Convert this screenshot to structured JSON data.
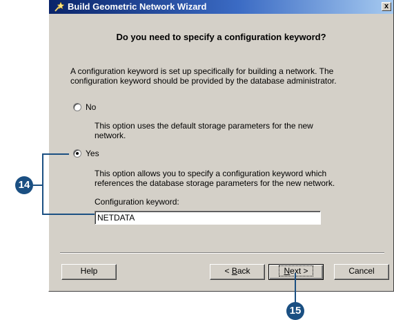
{
  "window": {
    "title": "Build Geometric Network Wizard",
    "close_label": "x"
  },
  "question": "Do you need to specify a configuration keyword?",
  "intro": {
    "line1": "A configuration keyword is set up specifically for building a network. The",
    "line2": "configuration keyword should be provided by the database administrator."
  },
  "options": {
    "no": {
      "label": "No",
      "selected": false,
      "desc_line1": "This option uses the default storage parameters for the new",
      "desc_line2": "network."
    },
    "yes": {
      "label": "Yes",
      "selected": true,
      "desc_line1": "This option allows you to specify a configuration keyword which",
      "desc_line2": "references the database storage parameters for the new network."
    }
  },
  "keyword": {
    "label": "Configuration keyword:",
    "value": "NETDATA"
  },
  "buttons": {
    "help": "Help",
    "back_prefix": "< ",
    "back_mnemonic": "B",
    "back_rest": "ack",
    "next_mnemonic": "N",
    "next_rest": "ext >",
    "cancel": "Cancel"
  },
  "callouts": {
    "step14": "14",
    "step15": "15"
  },
  "colors": {
    "titlebar_start": "#0a246a",
    "titlebar_end": "#a6caf0",
    "dialog_bg": "#d4d0c8",
    "callout": "#1a4f82"
  }
}
